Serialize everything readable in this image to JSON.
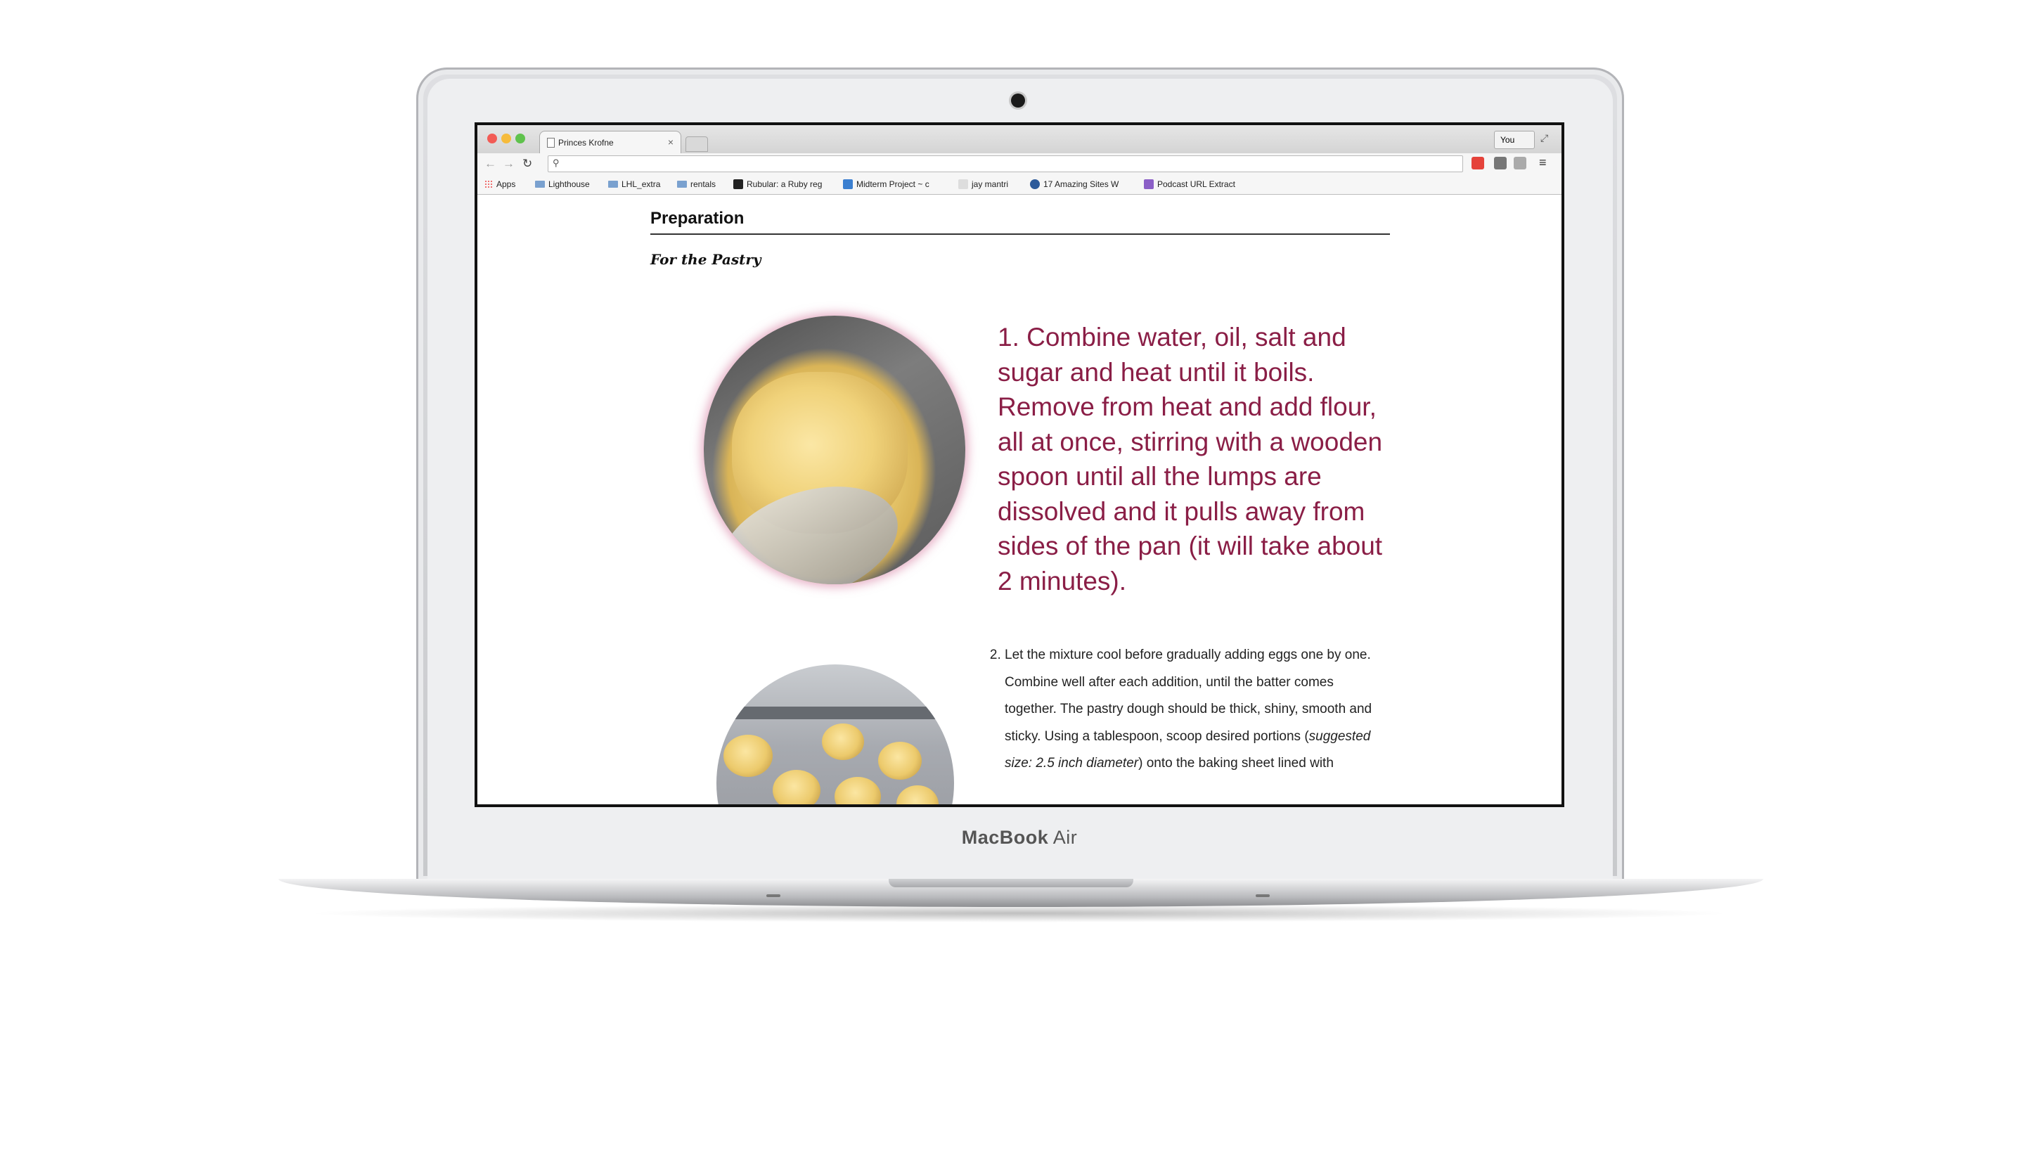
{
  "browser": {
    "tab_title": "Princes Krofne",
    "tab_close": "×",
    "user_label": "You",
    "omnibox_value": "",
    "bookmarks": [
      {
        "label": "Apps",
        "icon": "apps-grid-icon"
      },
      {
        "label": "Lighthouse",
        "icon": "folder-icon"
      },
      {
        "label": "LHL_extra",
        "icon": "folder-icon"
      },
      {
        "label": "rentals",
        "icon": "folder-icon"
      },
      {
        "label": "Rubular: a Ruby reg",
        "icon": "rubular-favicon"
      },
      {
        "label": "Midterm Project ~ c",
        "icon": "midterm-favicon"
      },
      {
        "label": "jay mantri",
        "icon": "jay-mantri-favicon"
      },
      {
        "label": "17 Amazing Sites W",
        "icon": "site-favicon"
      },
      {
        "label": "Podcast URL Extract",
        "icon": "podcast-favicon"
      }
    ]
  },
  "page": {
    "heading": "Preparation",
    "subheading": "For the Pastry",
    "step1": "1. Combine water, oil, salt and sugar and heat until it boils. Remove from heat and add flour, all at once, stirring with a wooden spoon until all the lumps are dissolved and it pulls away from sides of the pan (it will take about 2 minutes).",
    "step2_text": "Let the mixture cool before gradually adding eggs one by one. Combine well after each addition, until the batter comes together. The pastry dough should be thick, shiny, smooth and sticky. Using a tablespoon, scoop desired portions (",
    "step2_italic": "suggested size: 2.5 inch diameter",
    "step2_after": ") onto the baking sheet lined with"
  },
  "laptop": {
    "brand_bold": "MacBook",
    "brand_light": "Air"
  },
  "colors": {
    "step1_text": "#8a1e46",
    "photo_glow": "#d26e96"
  }
}
